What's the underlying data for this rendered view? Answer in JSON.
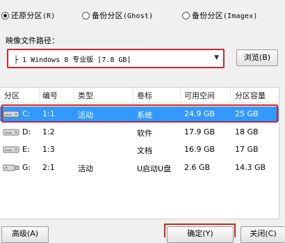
{
  "mode_options": [
    {
      "label": "还原分区",
      "shortcut": "(R)",
      "selected": true
    },
    {
      "label": "备份分区",
      "shortcut": "(Ghost)",
      "selected": false
    },
    {
      "label": "备份分区",
      "shortcut": "(Imagex)",
      "selected": false
    }
  ],
  "image": {
    "path_label": "映像文件路径：",
    "selected_value": "├ 1 Windows 8 专业版 [7.8 GB]",
    "browse_label": "浏览(B)"
  },
  "table": {
    "headers": [
      "分区",
      "编号",
      "类型",
      "卷标",
      "可用空间",
      "分区容量"
    ],
    "rows": [
      {
        "drive": "C:",
        "number": "1:1",
        "type": "活动",
        "label": "系统",
        "free": "24.9 GB",
        "capacity": "25 GB",
        "selected": true,
        "icon": "hard-disk-icon"
      },
      {
        "drive": "D:",
        "number": "1:2",
        "type": "",
        "label": "软件",
        "free": "17.9 GB",
        "capacity": "18 GB",
        "selected": false,
        "icon": "hard-disk-icon"
      },
      {
        "drive": "E:",
        "number": "1:3",
        "type": "",
        "label": "文档",
        "free": "16.9 GB",
        "capacity": "17 GB",
        "selected": false,
        "icon": "hard-disk-icon"
      },
      {
        "drive": "G:",
        "number": "2:1",
        "type": "活动",
        "label": "U启动U盘",
        "free": "2.6 GB",
        "capacity": "14.3 GB",
        "selected": false,
        "icon": "usb-drive-icon"
      }
    ]
  },
  "buttons": {
    "advanced": "高级(A)",
    "ok": "确定(Y)",
    "close": "关闭(C)"
  },
  "colors": {
    "selection": "#3399ff",
    "highlight_outline": "#c2272d"
  }
}
